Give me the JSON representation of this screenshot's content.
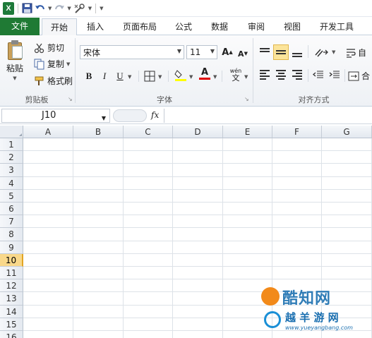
{
  "colors": {
    "file_tab": "#1f7a34",
    "accent_row": "#f9d88a",
    "selection": "#fbe49a"
  },
  "tabs": [
    "文件",
    "开始",
    "插入",
    "页面布局",
    "公式",
    "数据",
    "审阅",
    "视图",
    "开发工具"
  ],
  "clipboard": {
    "paste": "粘贴",
    "cut": "剪切",
    "copy": "复制",
    "format_painter": "格式刷",
    "group": "剪贴板"
  },
  "font": {
    "name": "宋体",
    "size": "11",
    "bold": "B",
    "italic": "I",
    "underline": "U",
    "group": "字体",
    "grow": "A",
    "shrink": "A",
    "color": "A",
    "wen": "wén"
  },
  "alignment": {
    "group": "对齐方式",
    "wrap": "自",
    "merge": "合"
  },
  "formula_bar": {
    "cell_ref": "J10",
    "fx": "fx",
    "value": ""
  },
  "columns": [
    "A",
    "B",
    "C",
    "D",
    "E",
    "F",
    "G"
  ],
  "rows": [
    "1",
    "2",
    "3",
    "4",
    "5",
    "6",
    "7",
    "8",
    "9",
    "10",
    "11",
    "12",
    "13",
    "14",
    "15",
    "16"
  ],
  "active_row": "10",
  "watermark": {
    "text1": "酷知网",
    "text2": "越 羊 游 网",
    "url": "www.yueyangbang.com"
  }
}
